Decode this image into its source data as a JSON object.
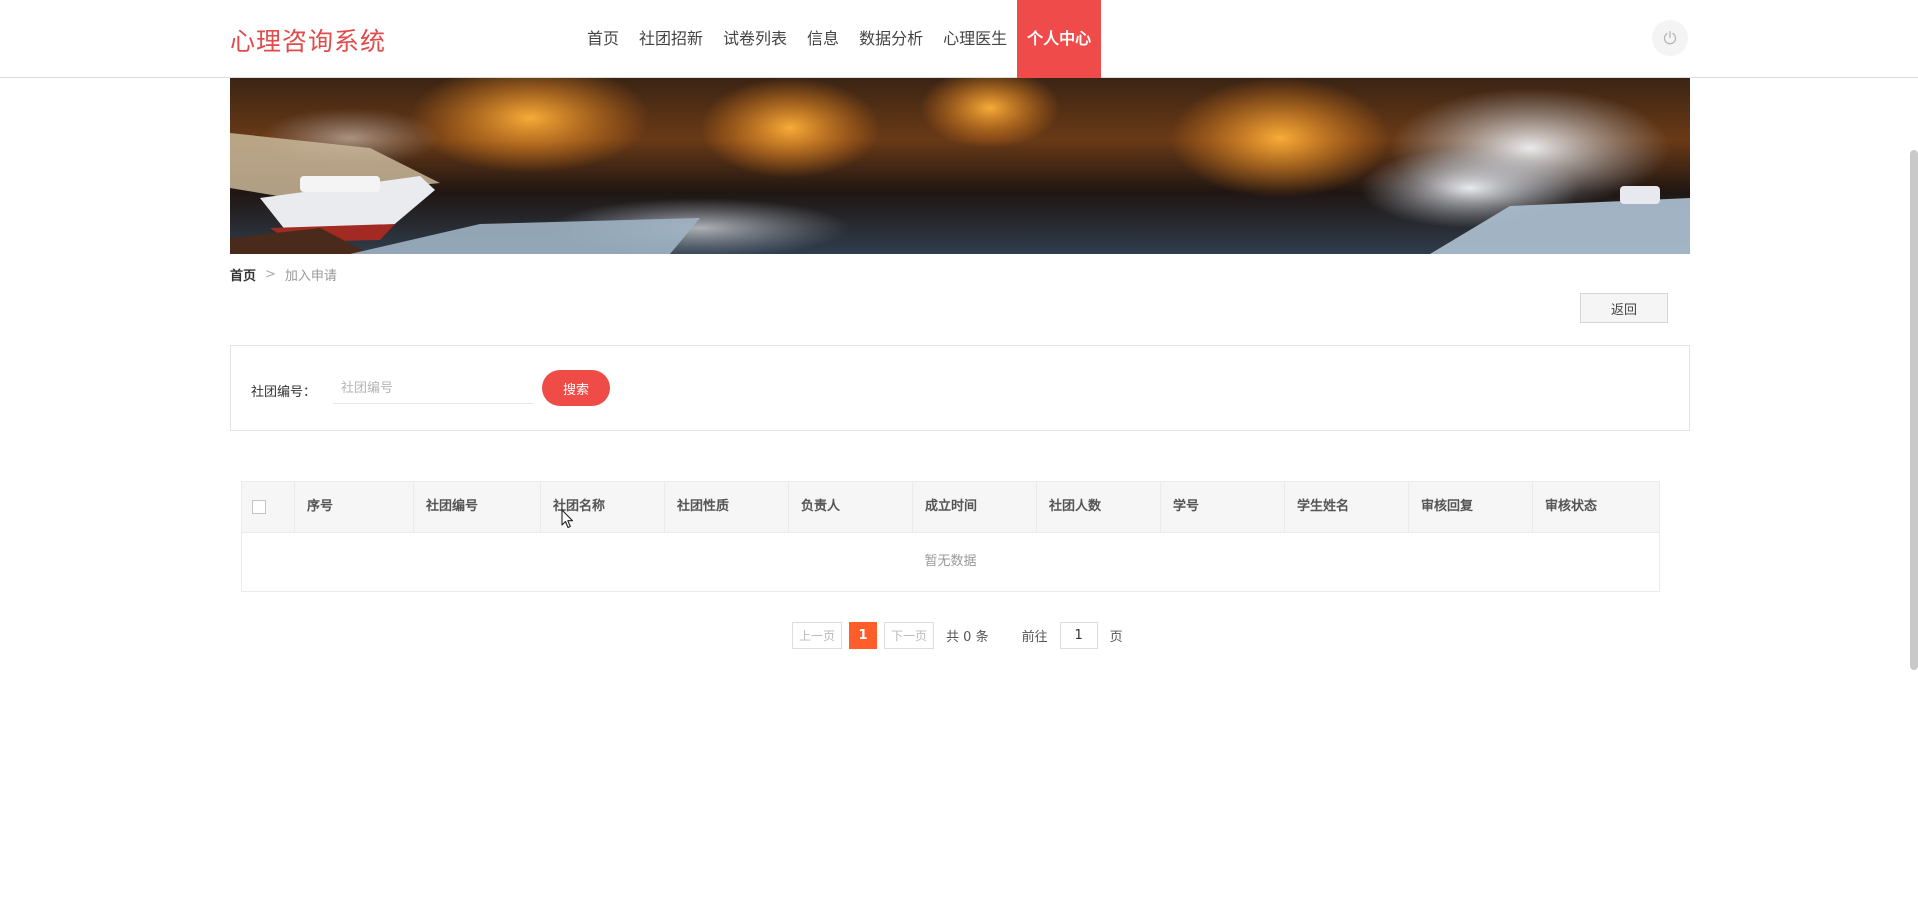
{
  "header": {
    "logo": "心理咨询系统",
    "nav": [
      {
        "label": "首页"
      },
      {
        "label": "社团招新"
      },
      {
        "label": "试卷列表"
      },
      {
        "label": "信息"
      },
      {
        "label": "数据分析"
      },
      {
        "label": "心理医生"
      },
      {
        "label": "个人中心",
        "active": true
      }
    ],
    "power_icon": "power-icon"
  },
  "breadcrumb": {
    "home": "首页",
    "separator": ">",
    "current": "加入申请"
  },
  "back_button": "返回",
  "search": {
    "label": "社团编号：",
    "placeholder": "社团编号",
    "button": "搜索"
  },
  "table": {
    "columns": [
      "序号",
      "社团编号",
      "社团名称",
      "社团性质",
      "负责人",
      "成立时间",
      "社团人数",
      "学号",
      "学生姓名",
      "审核回复",
      "审核状态"
    ],
    "empty_text": "暂无数据"
  },
  "pagination": {
    "prev": "上一页",
    "current_page": "1",
    "next": "下一页",
    "total": "共 0 条",
    "goto": "前往",
    "goto_value": "1",
    "page_suffix": "页"
  },
  "colors": {
    "brand": "#e14b4b",
    "active_nav": "#f04b4b",
    "search_button": "#ef4b47",
    "page_active": "#ff5d2a"
  }
}
